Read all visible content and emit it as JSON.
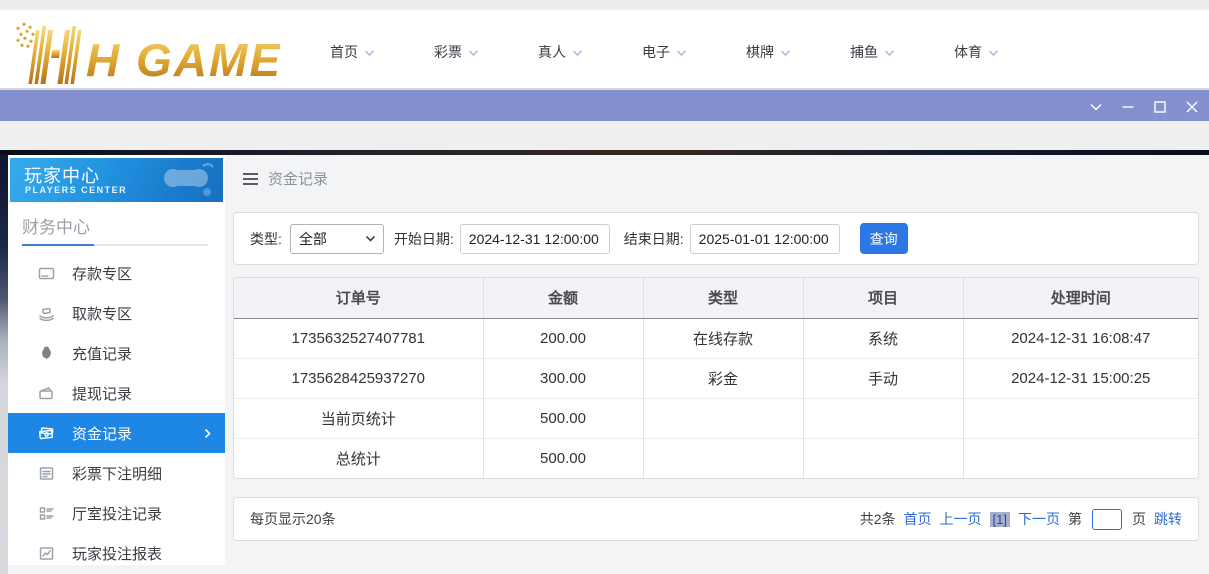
{
  "header": {
    "logo_text": "H GAME",
    "nav": [
      {
        "label": "首页"
      },
      {
        "label": "彩票"
      },
      {
        "label": "真人"
      },
      {
        "label": "电子"
      },
      {
        "label": "棋牌"
      },
      {
        "label": "捕鱼"
      },
      {
        "label": "体育"
      }
    ]
  },
  "sidebar": {
    "title": "玩家中心",
    "subtitle": "PLAYERS CENTER",
    "section": "财务中心",
    "items": [
      {
        "label": "存款专区"
      },
      {
        "label": "取款专区"
      },
      {
        "label": "充值记录"
      },
      {
        "label": "提现记录"
      },
      {
        "label": "资金记录"
      },
      {
        "label": "彩票下注明细"
      },
      {
        "label": "厅室投注记录"
      },
      {
        "label": "玩家投注报表"
      }
    ]
  },
  "main": {
    "breadcrumb": "资金记录",
    "filters": {
      "type_label": "类型:",
      "type_value": "全部",
      "start_label": "开始日期:",
      "start_value": "2024-12-31 12:00:00",
      "end_label": "结束日期:",
      "end_value": "2025-01-01 12:00:00",
      "search_button": "查询"
    },
    "table": {
      "headers": [
        "订单号",
        "金额",
        "类型",
        "项目",
        "处理时间"
      ],
      "rows": [
        [
          "1735632527407781",
          "200.00",
          "在线存款",
          "系统",
          "2024-12-31 16:08:47"
        ],
        [
          "1735628425937270",
          "300.00",
          "彩金",
          "手动",
          "2024-12-31 15:00:25"
        ],
        [
          "当前页统计",
          "500.00",
          "",
          "",
          ""
        ],
        [
          "总统计",
          "500.00",
          "",
          "",
          ""
        ]
      ]
    },
    "pagination": {
      "per_page": "每页显示20条",
      "total": "共2条",
      "first": "首页",
      "prev": "上一页",
      "current": "[1]",
      "next": "下一页",
      "jump_prefix": "第",
      "jump_suffix": "页",
      "jump_action": "跳转"
    }
  },
  "colors": {
    "titlebar_purple": "#8590ce",
    "sidebar_active_blue": "#1e86e4",
    "query_button_blue": "#2b78e4",
    "link_blue": "#2e6bd3",
    "table_divider_pink": "#f6dcdc",
    "logo_gold": "#d9a53a"
  }
}
